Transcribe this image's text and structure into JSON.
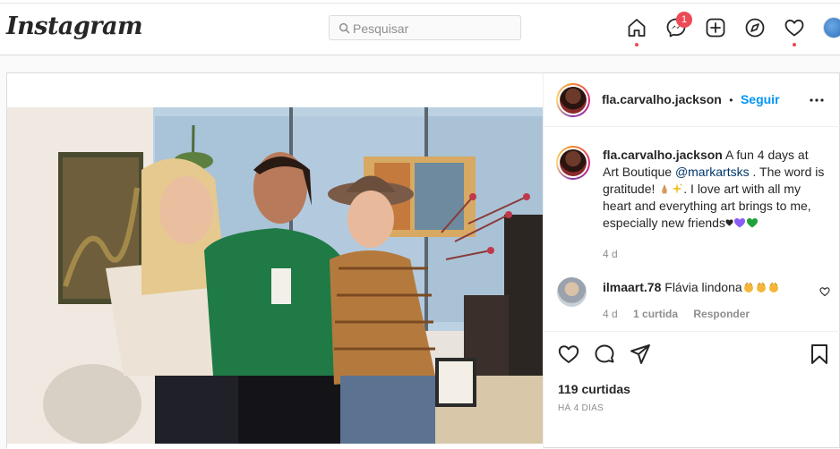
{
  "header": {
    "logo": "Instagram",
    "search_placeholder": "Pesquisar",
    "messages_badge": "1"
  },
  "post": {
    "author": "fla.carvalho.jackson",
    "separator": "•",
    "follow_label": "Seguir",
    "caption": {
      "username": "fla.carvalho.jackson",
      "text_1": " A fun 4 days at Art Boutique ",
      "mention": "@markartsks",
      "text_2": " . The word is gratitude! ",
      "text_3": ". I love art with all my heart and everything art brings to me, especially new friends",
      "time": "4 d"
    },
    "comment": {
      "username": "ilmaart.78",
      "text": " Flávia lindona",
      "time": "4 d",
      "likes": "1 curtida",
      "reply": "Responder"
    },
    "likes": "119 curtidas",
    "time_ago": "HÁ 4 DIAS"
  },
  "colors": {
    "accent": "#0095f6",
    "badge": "#ed4956",
    "text": "#262626",
    "muted": "#8e8e8e"
  },
  "icons": [
    "search-icon",
    "home-icon",
    "messenger-icon",
    "new-post-icon",
    "explore-icon",
    "activity-heart-icon",
    "more-icon",
    "like-icon",
    "comment-icon",
    "share-icon",
    "save-icon"
  ]
}
